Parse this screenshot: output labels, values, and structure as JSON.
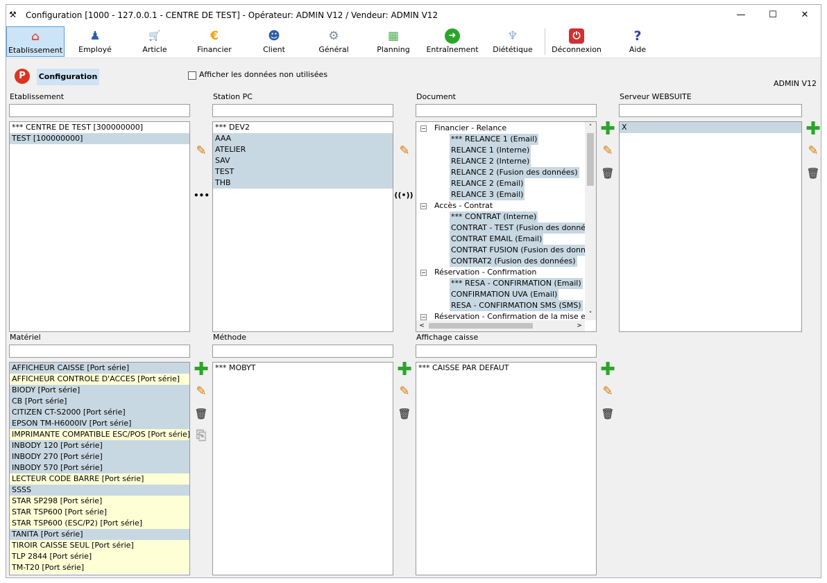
{
  "window": {
    "title": "Configuration [1000 - 127.0.0.1 - CENTRE DE TEST] - Opérateur: ADMIN V12 / Vendeur: ADMIN V12",
    "minimize": "—",
    "maximize": "☐",
    "close": "✕"
  },
  "toolbar": {
    "items": [
      {
        "label": "Etablissement",
        "icon": "⌂",
        "color": "#d9534f"
      },
      {
        "label": "Employé",
        "icon": "♟",
        "color": "#2d5fa8"
      },
      {
        "label": "Article",
        "icon": "🛒",
        "color": "#6aa84f"
      },
      {
        "label": "Financier",
        "icon": "€",
        "color": "#f0a000"
      },
      {
        "label": "Client",
        "icon": "☻",
        "color": "#2d5fa8"
      },
      {
        "label": "Général",
        "icon": "⚙",
        "color": "#7a8aa0"
      },
      {
        "label": "Planning",
        "icon": "▦",
        "color": "#4caf50"
      },
      {
        "label": "Entraînement",
        "icon": "➜",
        "color": "#2aa52a"
      },
      {
        "label": "Diététique",
        "icon": "♆",
        "color": "#8fb0c8"
      },
      {
        "label": "Déconnexion",
        "icon": "⏻",
        "color": "#d32f2f"
      },
      {
        "label": "Aide",
        "icon": "?",
        "color": "#2d3fa8"
      }
    ]
  },
  "subbar": {
    "logo": "P",
    "config_label": "Configuration",
    "show_unused_label": "Afficher les données non utilisées",
    "user": "ADMIN V12"
  },
  "etablissement": {
    "label": "Etablissement",
    "items": [
      "*** CENTRE DE TEST [300000000]",
      "TEST [100000000]"
    ],
    "more": "•••"
  },
  "station": {
    "label": "Station PC",
    "items": [
      "*** DEV2",
      "AAA",
      "ATELIER",
      "SAV",
      "TEST",
      "THB"
    ],
    "wifi": "((•))"
  },
  "document": {
    "label": "Document",
    "groups": [
      {
        "name": "Financier - Relance",
        "children": [
          "*** RELANCE 1 (Email)",
          "RELANCE 1 (Interne)",
          "RELANCE 2 (Interne)",
          "RELANCE 2 (Fusion des données)",
          "RELANCE 2 (Email)",
          "RELANCE 3 (Email)"
        ]
      },
      {
        "name": "Accès - Contrat",
        "children": [
          "*** CONTRAT (Interne)",
          "CONTRAT - TEST (Fusion des donné",
          "CONTRAT EMAIL (Email)",
          "CONTRAT FUSION (Fusion des donn",
          "CONTRAT2 (Fusion des données)"
        ]
      },
      {
        "name": "Réservation - Confirmation",
        "children": [
          "*** RESA - CONFIRMATION (Email)",
          "CONFIRMATION UVA (Email)",
          "RESA - CONFIRMATION SMS (SMS)"
        ]
      },
      {
        "name": "Réservation - Confirmation de la mise e",
        "children": []
      }
    ]
  },
  "websuite": {
    "label": "Serveur WEBSUITE",
    "items": [
      "X"
    ]
  },
  "materiel": {
    "label": "Matériel",
    "items": [
      {
        "text": "AFFICHEUR CAISSE [Port série]",
        "style": "hl"
      },
      {
        "text": "AFFICHEUR CONTROLE D'ACCES [Port série]",
        "style": "yl"
      },
      {
        "text": "BIODY [Port série]",
        "style": "hl"
      },
      {
        "text": "CB [Port série]",
        "style": "hl"
      },
      {
        "text": "CITIZEN CT-S2000 [Port série]",
        "style": "hl"
      },
      {
        "text": "EPSON TM-H6000IV [Port série]",
        "style": "hl"
      },
      {
        "text": "IMPRIMANTE COMPATIBLE ESC/POS [Port série]",
        "style": "yl"
      },
      {
        "text": "INBODY 120 [Port série]",
        "style": "hl"
      },
      {
        "text": "INBODY 270 [Port série]",
        "style": "hl"
      },
      {
        "text": "INBODY 570 [Port série]",
        "style": "hl"
      },
      {
        "text": "LECTEUR CODE BARRE [Port série]",
        "style": "yl"
      },
      {
        "text": "SSSS",
        "style": "hl"
      },
      {
        "text": "STAR SP298 [Port série]",
        "style": "yl"
      },
      {
        "text": "STAR TSP600 [Port série]",
        "style": "yl"
      },
      {
        "text": "STAR TSP600 (ESC/P2) [Port série]",
        "style": "yl"
      },
      {
        "text": "TANITA [Port série]",
        "style": "hl"
      },
      {
        "text": "TIROIR CAISSE SEUL [Port série]",
        "style": "yl"
      },
      {
        "text": "TLP 2844 [Port série]",
        "style": "yl"
      },
      {
        "text": "TM-T20 [Port série]",
        "style": "yl"
      }
    ]
  },
  "methode": {
    "label": "Méthode",
    "items": [
      "*** MOBYT"
    ]
  },
  "affichage": {
    "label": "Affichage caisse",
    "items": [
      "*** CAISSE PAR DEFAUT"
    ]
  },
  "buttons": {
    "plus": "✚",
    "edit": "✎",
    "trash": "🗑",
    "copy": "⎘"
  }
}
